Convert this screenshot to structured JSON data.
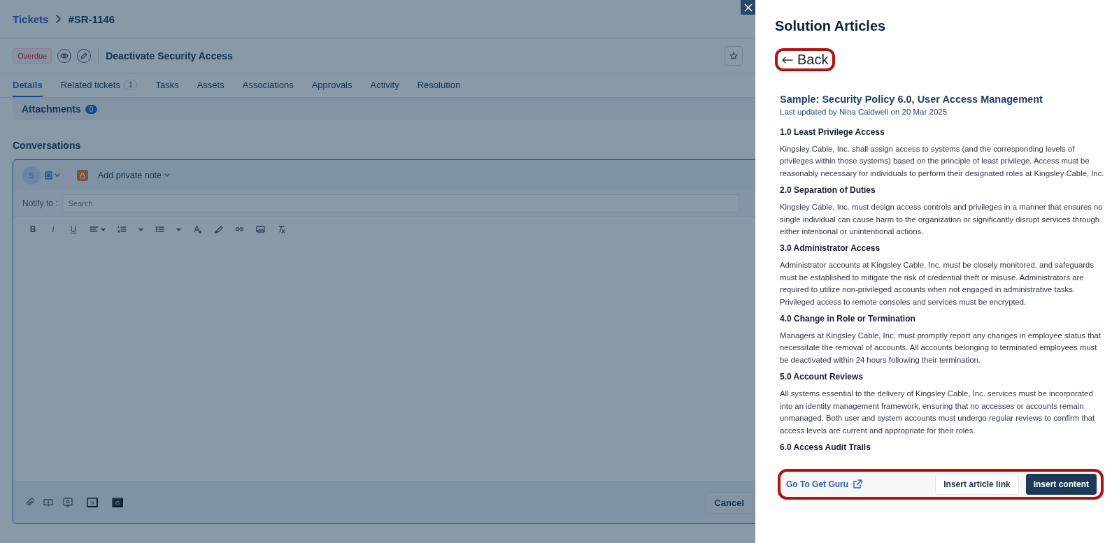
{
  "breadcrumb": {
    "parent": "Tickets",
    "current": "#SR-1146"
  },
  "ticket": {
    "status": "Overdue",
    "subject": "Deactivate Security Access"
  },
  "tabs": [
    {
      "label": "Details",
      "selected": true
    },
    {
      "label": "Related tickets",
      "count": "1",
      "selected": false
    },
    {
      "label": "Tasks",
      "selected": false
    },
    {
      "label": "Assets",
      "selected": false
    },
    {
      "label": "Associations",
      "selected": false
    },
    {
      "label": "Approvals",
      "selected": false
    },
    {
      "label": "Activity",
      "selected": false
    },
    {
      "label": "Resolution",
      "selected": false
    }
  ],
  "attachments": {
    "label": "Attachments",
    "count": "0"
  },
  "conversations": {
    "title": "Conversations",
    "avatar": "S",
    "note_type": "Add private note",
    "notify_label": "Notify to :",
    "notify_placeholder": "Search",
    "format_keys": [
      "B",
      "i",
      "U"
    ],
    "footer_badges": [
      {
        "label": "N",
        "kind": "light"
      },
      {
        "label": "G",
        "kind": "dark"
      }
    ],
    "cancel": "Cancel"
  },
  "drawer": {
    "title": "Solution Articles",
    "back": {
      "label": "Back",
      "highlighted": true
    },
    "article": {
      "title": "Sample: Security Policy 6.0, User Access Management",
      "updated": "Last updated by Nina Caldwell on 20 Mar 2025",
      "sections": [
        {
          "heading": "1.0 Least Privilege Access",
          "body": "Kingsley Cable, Inc. shall assign access to systems (and the corresponding levels of privileges within those systems) based on the principle of least privilege. Access must be reasonably necessary for individuals to perform their designated roles at Kingsley Cable, Inc."
        },
        {
          "heading": "2.0 Separation of Duties",
          "body": "Kingsley Cable, Inc. must design access controls and privileges in a manner that ensures no single individual can cause harm to the organization or significantly disrupt services through either intentional or unintentional actions."
        },
        {
          "heading": "3.0 Administrator Access",
          "body": "Administrator accounts at Kingsley Cable, Inc. must be closely monitored, and safeguards must be established to mitigate the risk of credential theft or misuse. Administrators are required to utilize non-privileged accounts when not engaged in administrative tasks. Privileged access to remote consoles and services must be encrypted."
        },
        {
          "heading": "4.0 Change in Role or Termination",
          "body": "Managers at Kingsley Cable, Inc. must promptly report any changes in employee status that necessitate the removal of accounts. All accounts belonging to terminated employees must be deactivated within 24 hours following their termination."
        },
        {
          "heading": "5.0 Account Reviews",
          "body": "All systems essential to the delivery of Kingsley Cable, Inc. services must be incorporated into an identity management framework, ensuring that no accesses or accounts remain unmanaged. Both user and system accounts must undergo regular reviews to confirm that access levels are current and appropriate for their roles."
        },
        {
          "heading": "6.0 Access Audit Trails"
        }
      ]
    },
    "footer": {
      "highlighted": true,
      "link": "Go To Get Guru",
      "secondary": "Insert article link",
      "primary": "Insert content"
    }
  }
}
